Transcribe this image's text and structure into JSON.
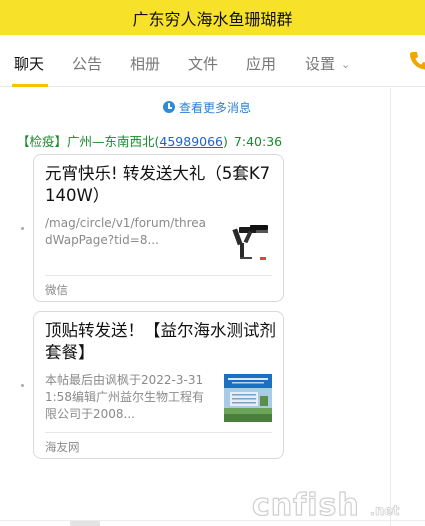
{
  "window": {
    "title": "广东穷人海水鱼珊瑚群"
  },
  "tabs": [
    {
      "label": "聊天",
      "active": true
    },
    {
      "label": "公告"
    },
    {
      "label": "相册"
    },
    {
      "label": "文件"
    },
    {
      "label": "应用"
    },
    {
      "label": "设置"
    }
  ],
  "header_icons": {
    "call": "phone-icon",
    "settings_menu": "chevron-down-icon"
  },
  "history": {
    "view_more": "查看更多消息",
    "icon": "clock-icon"
  },
  "message": {
    "sender_prefix": "【检疫】广州—东南西北(",
    "sender_qq": "45989066",
    "sender_suffix": ")",
    "time": "7:40:36"
  },
  "cards": [
    {
      "title": "元宵快乐! 转发送大礼（5套K7 140W）",
      "desc": "/mag/circle/v1/forum/threadWapPage?tid=8...",
      "source": "微信",
      "thumb": "aquarium-lamp-image"
    },
    {
      "title": "顶贴转发送！【益尔海水测试剂套餐】",
      "desc": "本帖最后由讽枫于2022-3-311:58编辑广州益尔生物工程有限公司于2008...",
      "source": "海友网",
      "thumb": "company-building-image"
    }
  ],
  "watermark": {
    "text": "cnfish",
    "suffix": ".net"
  },
  "colors": {
    "title_bar": "#f7e229",
    "tab_underline": "#f7c300",
    "sender": "#168a2d",
    "link": "#1c64c9",
    "phone": "#f0a500"
  }
}
